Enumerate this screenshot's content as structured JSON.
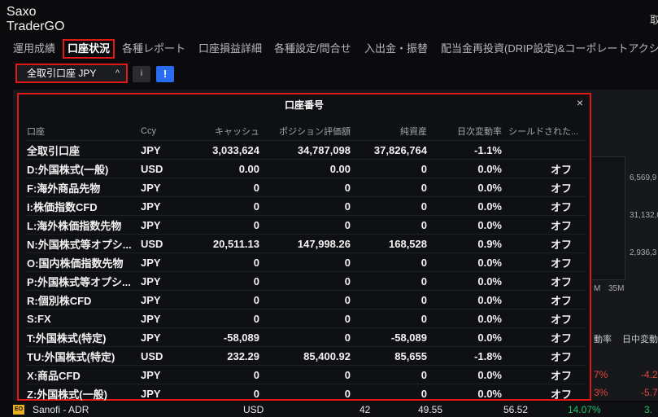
{
  "app": {
    "title_line1": "Saxo",
    "title_line2": "TraderGO",
    "corner_glyph": "取"
  },
  "nav": {
    "tabs": [
      {
        "label": "運用成績"
      },
      {
        "label": "口座状況"
      },
      {
        "label": "各種レポート"
      },
      {
        "label": "口座損益詳細"
      },
      {
        "label": "各種設定/問合せ"
      },
      {
        "label": "入出金・振替"
      },
      {
        "label": "配当金再投資(DRIP設定)&コーポレートアクション"
      }
    ]
  },
  "account_selector": {
    "value": "全取引口座  JPY",
    "chevron": "^"
  },
  "info_button": {
    "label": "i"
  },
  "alert_button": {
    "label": "!"
  },
  "background": {
    "chart_values": [
      "6,569,9",
      "31,132,0",
      "2,936,3"
    ],
    "axis_label": "35M",
    "axis_prefix": "M",
    "col_headers": [
      "動率",
      "日中変動"
    ],
    "red_values": [
      [
        "7%",
        "-4.2"
      ],
      [
        "3%",
        "-5.7"
      ]
    ],
    "bottom_row": {
      "badge": "EO",
      "name": "Sanofi - ADR",
      "ccy": "USD",
      "qty": "42",
      "price": "49.55",
      "value": "56.52",
      "pct": "14.07%",
      "extra": "3."
    }
  },
  "modal": {
    "title": "口座番号",
    "close": "×",
    "columns": [
      "口座",
      "Ccy",
      "キャッシュ",
      "ポジション評価額",
      "純資産",
      "日次変動率",
      "シールドされた..."
    ],
    "rows": [
      [
        "全取引口座",
        "JPY",
        "3,033,624",
        "34,787,098",
        "37,826,764",
        "-1.1%",
        ""
      ],
      [
        "D:外国株式(一般)",
        "USD",
        "0.00",
        "0.00",
        "0",
        "0.0%",
        "オフ"
      ],
      [
        "F:海外商品先物",
        "JPY",
        "0",
        "0",
        "0",
        "0.0%",
        "オフ"
      ],
      [
        "I:株価指数CFD",
        "JPY",
        "0",
        "0",
        "0",
        "0.0%",
        "オフ"
      ],
      [
        "L:海外株価指数先物",
        "JPY",
        "0",
        "0",
        "0",
        "0.0%",
        "オフ"
      ],
      [
        "N:外国株式等オプシ...",
        "USD",
        "20,511.13",
        "147,998.26",
        "168,528",
        "0.9%",
        "オフ"
      ],
      [
        "O:国内株価指数先物",
        "JPY",
        "0",
        "0",
        "0",
        "0.0%",
        "オフ"
      ],
      [
        "P:外国株式等オプシ...",
        "JPY",
        "0",
        "0",
        "0",
        "0.0%",
        "オフ"
      ],
      [
        "R:個別株CFD",
        "JPY",
        "0",
        "0",
        "0",
        "0.0%",
        "オフ"
      ],
      [
        "S:FX",
        "JPY",
        "0",
        "0",
        "0",
        "0.0%",
        "オフ"
      ],
      [
        "T:外国株式(特定)",
        "JPY",
        "-58,089",
        "0",
        "-58,089",
        "0.0%",
        "オフ"
      ],
      [
        "TU:外国株式(特定)",
        "USD",
        "232.29",
        "85,400.92",
        "85,655",
        "-1.8%",
        "オフ"
      ],
      [
        "X:商品CFD",
        "JPY",
        "0",
        "0",
        "0",
        "0.0%",
        "オフ"
      ],
      [
        "Z:外国株式(一般)",
        "JPY",
        "0",
        "0",
        "0",
        "0.0%",
        "オフ"
      ]
    ]
  }
}
